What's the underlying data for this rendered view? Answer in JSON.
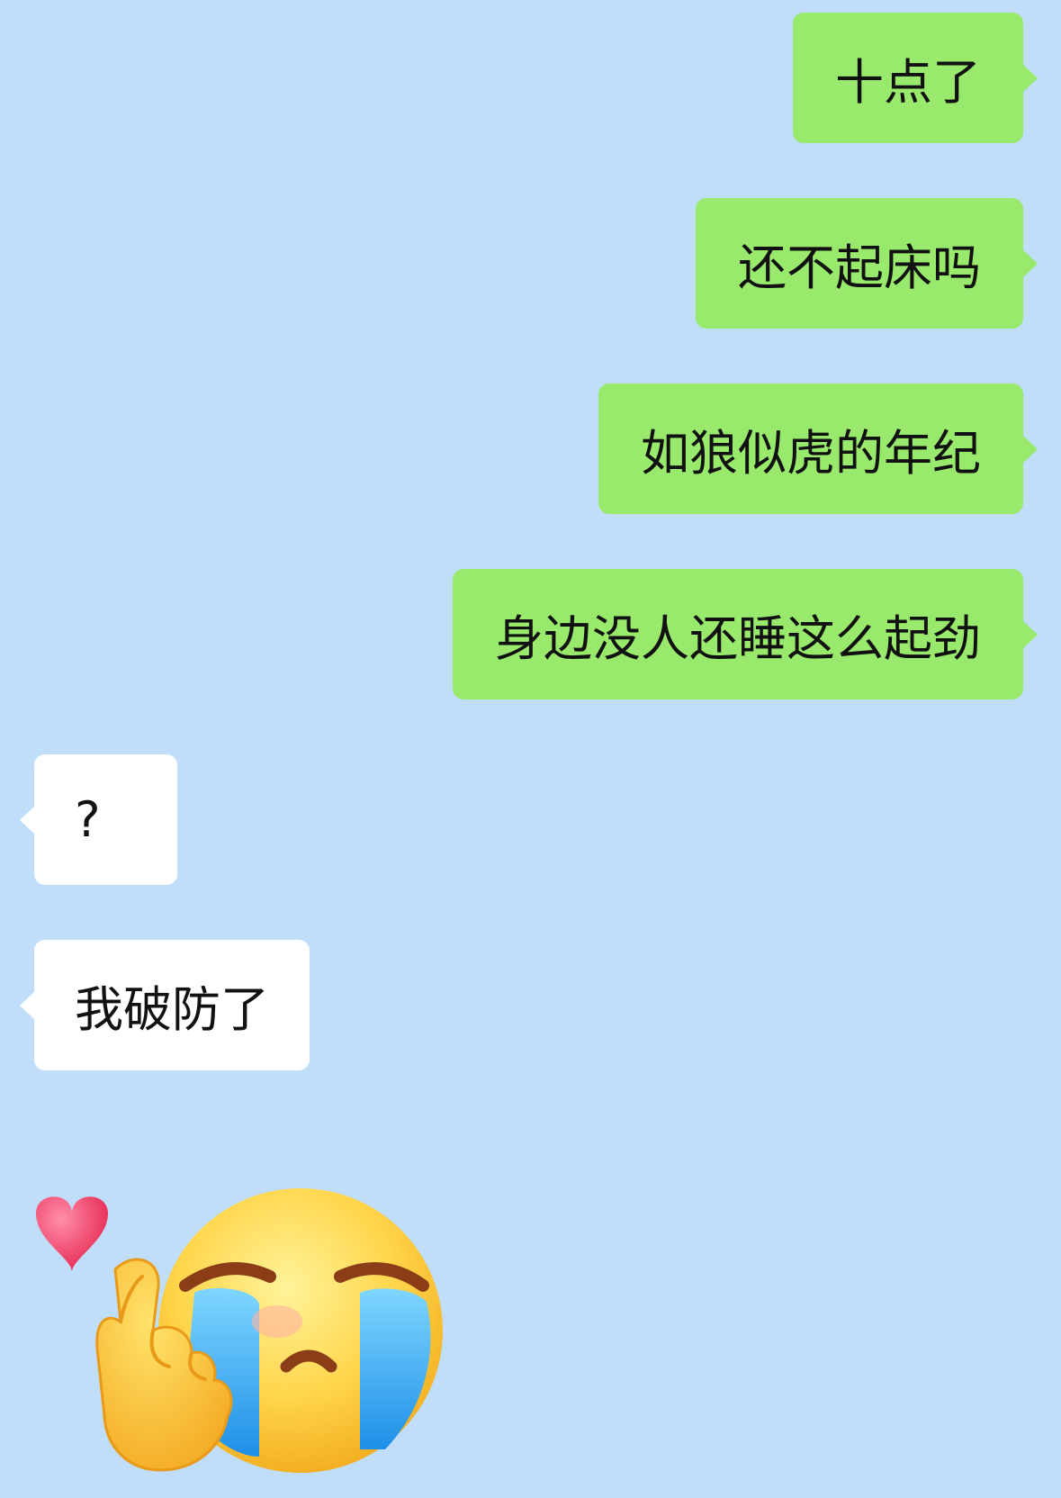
{
  "chat": {
    "messages": [
      {
        "side": "sent",
        "text": "十点了"
      },
      {
        "side": "sent",
        "text": "还不起床吗"
      },
      {
        "side": "sent",
        "text": "如狼似虎的年纪"
      },
      {
        "side": "sent",
        "text": "身边没人还睡这么起劲"
      },
      {
        "side": "received",
        "text": "?"
      },
      {
        "side": "received",
        "text": "我破防了"
      }
    ],
    "sticker": {
      "icon": "crying-face-finger-heart-icon",
      "description_icons": [
        "heart-icon",
        "finger-heart-hand-icon",
        "crying-face-icon"
      ]
    }
  },
  "colors": {
    "background": "#c0def9",
    "sent_bubble": "#98e96c",
    "received_bubble": "#ffffff",
    "text": "#111111"
  }
}
